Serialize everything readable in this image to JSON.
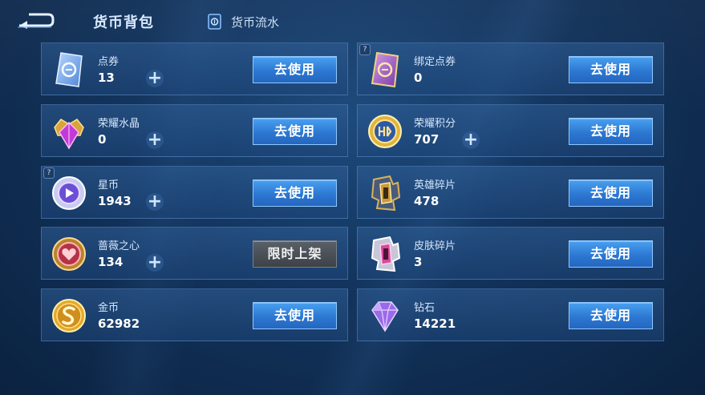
{
  "header": {
    "title": "货币背包",
    "flow_tab": "货币流水"
  },
  "cards": [
    {
      "name": "点券",
      "amount": "13",
      "button": "去使用",
      "has_plus": true,
      "has_help": false,
      "icon": "coupon-icon"
    },
    {
      "name": "绑定点券",
      "amount": "0",
      "button": "去使用",
      "has_plus": false,
      "has_help": true,
      "icon": "bound-coupon-icon"
    },
    {
      "name": "荣耀水晶",
      "amount": "0",
      "button": "去使用",
      "has_plus": true,
      "has_help": false,
      "icon": "glory-crystal-icon"
    },
    {
      "name": "荣耀积分",
      "amount": "707",
      "button": "去使用",
      "has_plus": true,
      "has_help": false,
      "icon": "glory-points-icon"
    },
    {
      "name": "星币",
      "amount": "1943",
      "button": "去使用",
      "has_plus": true,
      "has_help": true,
      "icon": "star-coin-icon"
    },
    {
      "name": "英雄碎片",
      "amount": "478",
      "button": "去使用",
      "has_plus": false,
      "has_help": false,
      "icon": "hero-fragment-icon"
    },
    {
      "name": "蔷薇之心",
      "amount": "134",
      "button": "限时上架",
      "has_plus": true,
      "has_help": false,
      "icon": "rose-heart-icon"
    },
    {
      "name": "皮肤碎片",
      "amount": "3",
      "button": "去使用",
      "has_plus": false,
      "has_help": false,
      "icon": "skin-fragment-icon"
    },
    {
      "name": "金币",
      "amount": "62982",
      "button": "去使用",
      "has_plus": false,
      "has_help": false,
      "icon": "gold-coin-icon"
    },
    {
      "name": "钻石",
      "amount": "14221",
      "button": "去使用",
      "has_plus": false,
      "has_help": false,
      "icon": "diamond-icon"
    }
  ],
  "colors": {
    "button_blue": "#2c78d2",
    "button_disabled": "#4a5057",
    "background": "#12335c"
  }
}
